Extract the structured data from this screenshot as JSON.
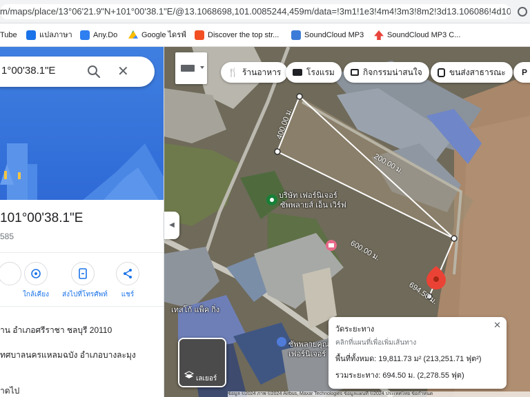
{
  "browser": {
    "url": "m/maps/place/13°06'21.9\"N+101°00'38.1\"E/@13.1068698,101.0085244,459m/data=!3m1!1e3!4m4!3m3!8m2!3d13.106086!4d101..."
  },
  "bookmarks": [
    {
      "label": "Tube",
      "color": "#ff0000"
    },
    {
      "label": "แปลภาษา",
      "color": "#1a73e8"
    },
    {
      "label": "Any.Do",
      "color": "#2e7ff0"
    },
    {
      "label": "Google ไดรฟ์",
      "color": "#fbbc04"
    },
    {
      "label": "Discover the top str...",
      "color": "#f25022"
    },
    {
      "label": "SoundCloud MP3",
      "color": "#3d7bd8"
    },
    {
      "label": "SoundCloud MP3 C...",
      "color": "#e8453c"
    }
  ],
  "panel": {
    "search_query": "1°00'38.1\"E",
    "coordinates": "101°00'38.1\"E",
    "plus_code": "585",
    "actions": [
      {
        "label": "ใกล้เคียง",
        "icon": "nearby-icon"
      },
      {
        "label": "ส่งไปที่โทรศัพท์",
        "icon": "send-to-phone-icon"
      },
      {
        "label": "แชร์",
        "icon": "share-icon"
      }
    ],
    "address_line_1": "าน อำเภอศรีราชา ชลบุรี 20110",
    "address_line_2": "ทศบาลนครแหลมฉบัง อำเภอบางละมุง",
    "address_line_3": "าดไป"
  },
  "map": {
    "chips": [
      {
        "label": "ร้านอาหาร",
        "icon": "restaurant-icon"
      },
      {
        "label": "โรงแรม",
        "icon": "hotel-icon"
      },
      {
        "label": "กิจกรรมน่าสนใจ",
        "icon": "camera-icon"
      },
      {
        "label": "ขนส่งสาธารณะ",
        "icon": "transit-icon"
      },
      {
        "label": "P",
        "icon": "parking-icon"
      }
    ],
    "distance_labels": [
      "400.00 ม.",
      "200.00 ม.",
      "600.00 ม.",
      "694.50 ม."
    ],
    "place_labels": [
      "บริษัท เฟอร์นิเจอร์",
      "ซัพพลายส์ เอ็น เวิร์ฟ",
      "เทสโก้ แพ็ค กิ่ง",
      "ซัพพลายคุณภาพ",
      "เฟอร์นิเจอร์"
    ],
    "satellite_label": "เลเยอร์",
    "attribution": "ข้อมูล ©2024 ภาพ ©2024 Airbus, Maxar Technologies ข้อมูลแผนที่ ©2024   ประเทศไทย   ข้อกำหนด"
  },
  "measure": {
    "title": "วัดระยะทาง",
    "hint": "คลิกที่แผนที่เพื่อเพิ่มเส้นทาง",
    "area": "พื้นที่ทั้งหมด: 19,811.73 ม² (213,251.71 ฟุต²)",
    "distance": "รวมระยะทาง: 694.50 ม. (2,278.55 ฟุต)"
  },
  "colors": {
    "accent": "#1a73e8",
    "pin": "#ea4335"
  }
}
